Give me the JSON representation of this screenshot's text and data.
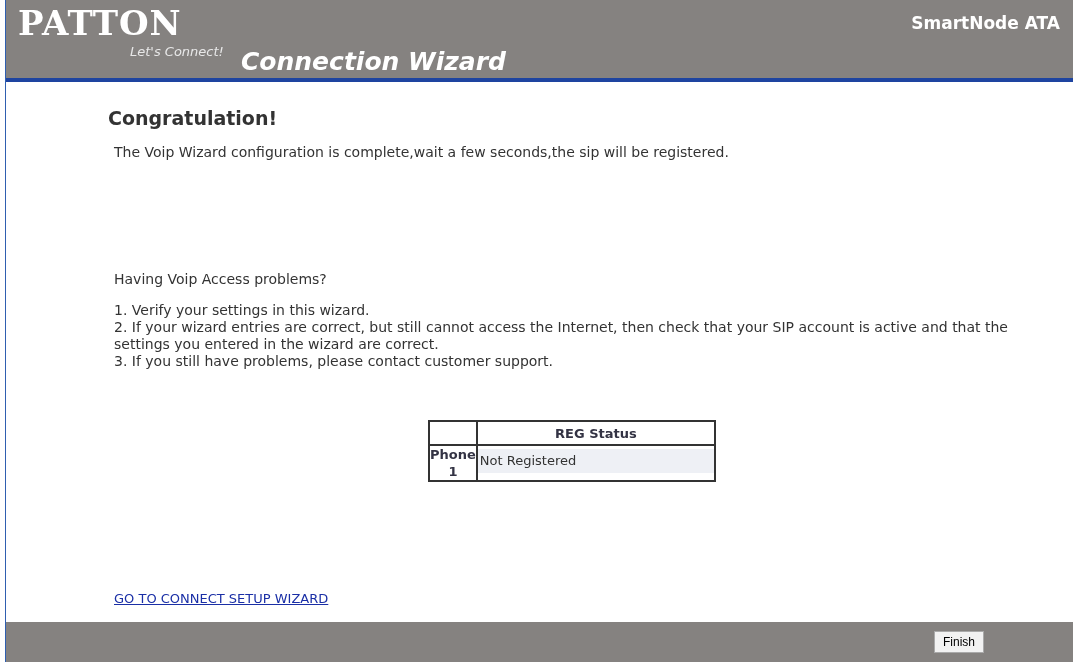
{
  "header": {
    "logo": "PATTON",
    "tagline": "Let's Connect!",
    "title": "Connection Wizard",
    "product": "SmartNode ATA"
  },
  "heading": "Congratulation!",
  "message": "The Voip Wizard configuration is complete,wait a few seconds,the sip will be registered.",
  "help_title": "Having Voip Access problems?",
  "help_steps": [
    "1. Verify your settings in this wizard.",
    "2. If your wizard entries are correct, but still cannot access the Internet, then check that your SIP account is active and that the settings you entered in the wizard are correct.",
    "3. If you still have problems, please contact customer support."
  ],
  "table": {
    "columns": [
      "REG Status"
    ],
    "rows": [
      {
        "label": "Phone 1",
        "status": "Not Registered"
      }
    ]
  },
  "link": "GO TO CONNECT SETUP WIZARD",
  "buttons": [
    "Finish"
  ]
}
